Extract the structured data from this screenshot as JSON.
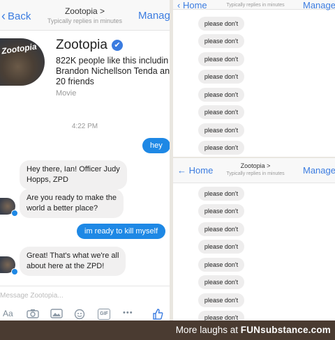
{
  "left_chat": {
    "header": {
      "back_label": "Back",
      "title": "Zootopia",
      "title_chevron": ">",
      "subtitle": "Typically replies in minutes",
      "manage_label": "Manag"
    },
    "profile": {
      "avatar_text": "Zootopia",
      "name": "Zootopia",
      "verified_glyph": "✔",
      "likes_text": "822K people like this includin\nBrandon Nichellson Tenda an\n20 friends",
      "category": "Movie"
    },
    "timestamp": "4:22 PM",
    "messages": [
      {
        "sender": "me",
        "text": "hey"
      },
      {
        "sender": "page",
        "text": "Hey there, Ian! Officer Judy\nHopps, ZPD"
      },
      {
        "sender": "page",
        "text": "Are you ready to make the\nworld a better place?"
      },
      {
        "sender": "me",
        "text": "im ready to kill myself"
      },
      {
        "sender": "page",
        "text": "Great! That's what we're all\nabout here at the ZPD!"
      }
    ],
    "composer": {
      "placeholder": "Message Zootopia...",
      "gif_label": "GIF",
      "more_label": "•••"
    }
  },
  "right_top": {
    "header": {
      "home_label": "Home",
      "subtitle": "Typically replies in minutes",
      "manage_label": "Manage"
    },
    "messages": [
      "please don't",
      "please don't",
      "please don't",
      "please don't",
      "please don't",
      "please don't",
      "please don't",
      "please don't"
    ]
  },
  "right_bottom": {
    "header": {
      "home_label": "Home",
      "title": "Zootopia",
      "title_chevron": ">",
      "subtitle": "Typically replies in minutes",
      "manage_label": "Manage"
    },
    "messages": [
      "please don't",
      "please don't",
      "please don't",
      "please don't",
      "please don't",
      "please don't",
      "please don't",
      "please don't"
    ]
  },
  "footer": {
    "prefix": "More laughs at",
    "brand": "FUNsubstance.com"
  },
  "colors": {
    "accent": "#3b7ce0",
    "outgoing_bubble": "#1e88e5",
    "incoming_bubble": "#f1f0f0",
    "footer_bg": "#4a3b31"
  }
}
